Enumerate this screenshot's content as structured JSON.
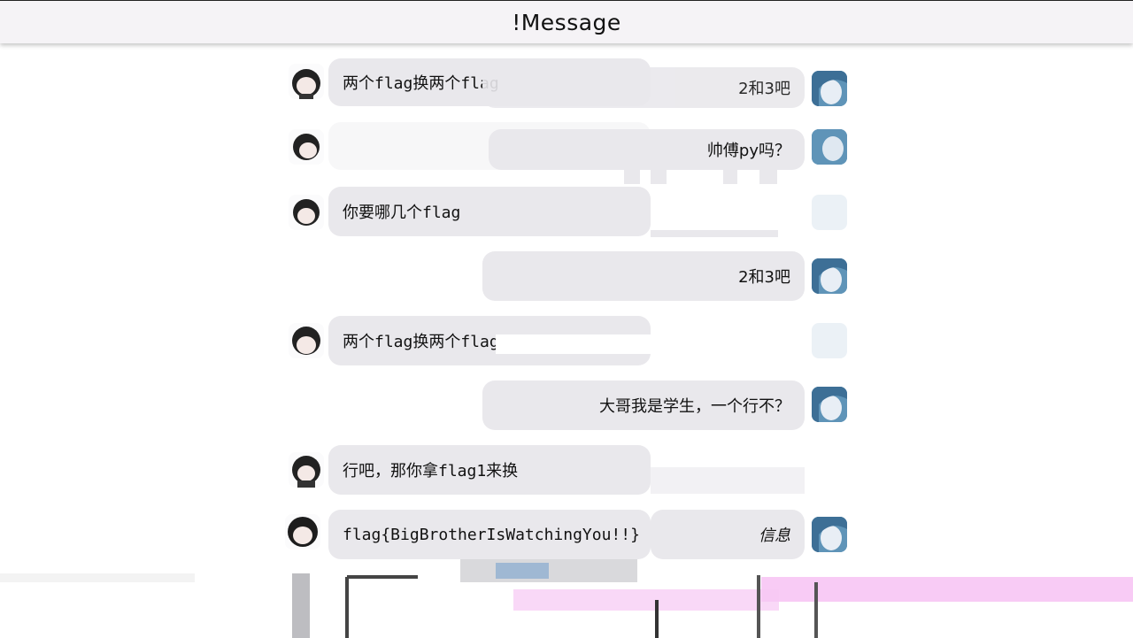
{
  "window": {
    "title": "!Message"
  },
  "messages": [
    {
      "side": "left",
      "text": "两个flag换两个flag"
    },
    {
      "side": "right",
      "text": "2和3吧"
    },
    {
      "side": "right",
      "text": "帅傅py吗？"
    },
    {
      "side": "left",
      "text": "你要哪几个flag"
    },
    {
      "side": "right",
      "text": "2和3吧"
    },
    {
      "side": "left",
      "text": "两个flag换两个flag"
    },
    {
      "side": "right",
      "text": "大哥我是学生，一个行不？"
    },
    {
      "side": "left",
      "text": "行吧，那你拿flag1来换"
    },
    {
      "side": "left",
      "text": "flag{BigBrotherIsWatchingYou!!}"
    },
    {
      "side": "right",
      "text": "信息"
    }
  ],
  "avatars": {
    "left": "girl-avatar-icon",
    "right": "blue-hair-avatar-icon"
  },
  "colors": {
    "bubble": "#e9e8ec",
    "titlebar": "#f5f3f6",
    "glitch_pink": "#f4a9ef"
  }
}
